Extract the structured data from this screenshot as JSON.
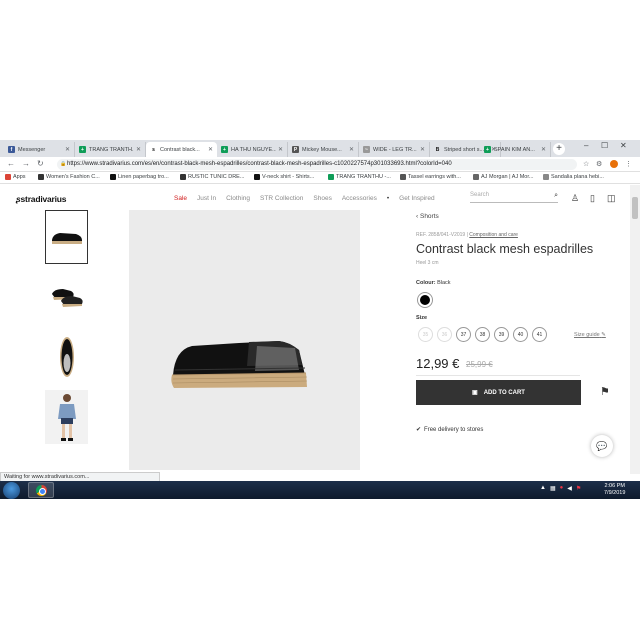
{
  "browser": {
    "tabs": [
      {
        "title": "Messenger",
        "favicon_color": "#3b5998",
        "favicon_glyph": "f"
      },
      {
        "title": "TRANG TRANTH...",
        "favicon_color": "#0f9d58",
        "favicon_glyph": "+"
      },
      {
        "title": "Contrast black...",
        "favicon_color": "#ffffff",
        "favicon_glyph": "s"
      },
      {
        "title": "HA THU NGUYE...",
        "favicon_color": "#0f9d58",
        "favicon_glyph": "+"
      },
      {
        "title": "Mickey Mouse...",
        "favicon_color": "#555555",
        "favicon_glyph": "P"
      },
      {
        "title": "WIDE - LEG TR...",
        "favicon_color": "#999999",
        "favicon_glyph": "~"
      },
      {
        "title": "Striped short s...",
        "favicon_color": "#ffffff",
        "favicon_glyph": "B"
      },
      {
        "title": "SPAIN KIM AN...",
        "favicon_color": "#0f9d58",
        "favicon_glyph": "+"
      }
    ],
    "new_tab": "+",
    "window_controls": [
      "–",
      "☐",
      "✕"
    ],
    "url": "https://www.stradivarius.com/es/en/contrast-black-mesh-espadrilles/contrast-black-mesh-espadrilles-c1020227574p301033693.html?colorId=040",
    "bookmarks": [
      {
        "label": "Apps",
        "color": "#db4437"
      },
      {
        "label": "Women's Fashion C...",
        "color": "#333333"
      },
      {
        "label": "Linen paperbag tro...",
        "color": "#111111"
      },
      {
        "label": "RUSTIC TUNIC DRE...",
        "color": "#333333"
      },
      {
        "label": "V-neck shirt - Shirts...",
        "color": "#111111"
      },
      {
        "label": "TRANG TRANTHU -...",
        "color": "#0f9d58"
      },
      {
        "label": "Tassel earrings with...",
        "color": "#555555"
      },
      {
        "label": "AJ Morgan | AJ Mor...",
        "color": "#666666"
      },
      {
        "label": "Sandalia plana hebi...",
        "color": "#888888"
      }
    ],
    "status_text": "Waiting for www.stradivarius.com..."
  },
  "site": {
    "logo": "stradivarius",
    "nav": [
      "Sale",
      "Just In",
      "Clothing",
      "STR Collection",
      "Shoes",
      "Accessories",
      "•",
      "Get Inspired"
    ],
    "search_placeholder": "Search",
    "accent": "#d11c1c"
  },
  "product": {
    "back_label": "Shorts",
    "ref": "REF. 2858/041-V2019",
    "ref_link": "Composition and care",
    "title": "Contrast black mesh espadrilles",
    "subtitle": "Heel 3 cm",
    "colour_label": "Colour:",
    "colour_value": "Black",
    "size_label": "Size",
    "sizes": [
      {
        "label": "35",
        "available": false
      },
      {
        "label": "36",
        "available": false
      },
      {
        "label": "37",
        "available": true
      },
      {
        "label": "38",
        "available": true
      },
      {
        "label": "39",
        "available": true
      },
      {
        "label": "40",
        "available": true
      },
      {
        "label": "41",
        "available": true
      }
    ],
    "size_guide": "Size guide",
    "price": "12,99 €",
    "old_price": "25,99 €",
    "add_to_cart": "ADD TO CART",
    "delivery": "Free delivery to stores"
  },
  "taskbar": {
    "time": "2:06 PM",
    "date": "7/9/2019"
  }
}
